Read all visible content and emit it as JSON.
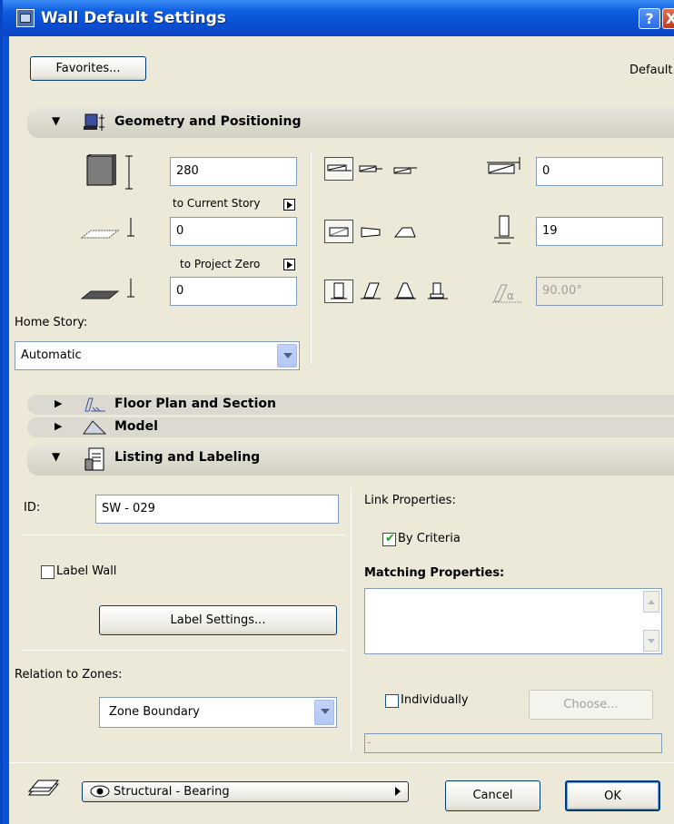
{
  "window": {
    "title": "Wall Default Settings",
    "help_label": "?",
    "close_label": "X"
  },
  "top": {
    "favorites_label": "Favorites...",
    "default_label": "Default"
  },
  "geometry": {
    "header": "Geometry and Positioning",
    "height_value": "280",
    "to_current_story": "to Current Story",
    "base_offset_value": "0",
    "to_project_zero": "to Project Zero",
    "bottom_value": "0",
    "home_story_label": "Home Story:",
    "home_story_value": "Automatic",
    "ref_offset_value": "0",
    "thickness_value": "19",
    "angle_value": "90.00°"
  },
  "panels": {
    "floor_plan": "Floor Plan and Section",
    "model": "Model",
    "listing": "Listing and Labeling"
  },
  "listing": {
    "id_label": "ID:",
    "id_value": "SW - 029",
    "label_wall": "Label Wall",
    "label_settings": "Label Settings...",
    "relation_label": "Relation to Zones:",
    "relation_value": "Zone Boundary",
    "link_properties": "Link Properties:",
    "by_criteria": "By Criteria",
    "matching_properties": "Matching Properties:",
    "individually": "Individually",
    "choose": "Choose...",
    "bottom_field": "-"
  },
  "footer": {
    "layer_value": "Structural - Bearing",
    "cancel": "Cancel",
    "ok": "OK"
  },
  "colors": {
    "titlebar": "#0a4ed0",
    "client": "#ece9d8",
    "checkmark": "#21a121"
  }
}
